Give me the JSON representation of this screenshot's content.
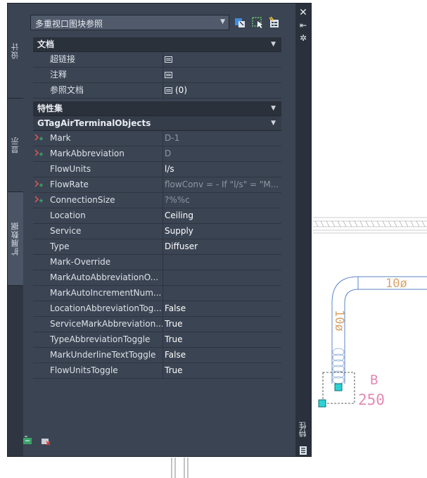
{
  "view_selector": {
    "value": "多重视口图块参照"
  },
  "tabs": [
    {
      "label": "设计"
    },
    {
      "label": "显示"
    },
    {
      "label": "扩展数据"
    }
  ],
  "right_strip": {
    "label": "特性"
  },
  "sections": {
    "document": {
      "title": "文档",
      "rows": [
        {
          "name": "超链接",
          "value": ""
        },
        {
          "name": "注释",
          "value": ""
        },
        {
          "name": "参照文档",
          "value": "(0)"
        }
      ]
    },
    "property_sets": {
      "title": "特性集"
    },
    "gtag": {
      "title": "GTagAirTerminalObjects",
      "rows": [
        {
          "name": "Mark",
          "value": "D-1",
          "dim": true
        },
        {
          "name": "MarkAbbreviation",
          "value": "D",
          "dim": true
        },
        {
          "name": "FlowUnits",
          "value": "l/s"
        },
        {
          "name": "FlowRate",
          "value": "flowConv = - If \"l/s\" = \"M...",
          "dim": true
        },
        {
          "name": "ConnectionSize",
          "value": "?%%c",
          "dim": true
        },
        {
          "name": "Location",
          "value": "Ceiling"
        },
        {
          "name": "Service",
          "value": "Supply"
        },
        {
          "name": "Type",
          "value": "Diffuser"
        },
        {
          "name": "Mark-Override",
          "value": ""
        },
        {
          "name": "MarkAutoAbbreviationO...",
          "value": ""
        },
        {
          "name": "MarkAutoIncrementNum...",
          "value": ""
        },
        {
          "name": "LocationAbbreviationTog...",
          "value": "False"
        },
        {
          "name": "ServiceMarkAbbreviation...",
          "value": "True"
        },
        {
          "name": "TypeAbbreviationToggle",
          "value": "True"
        },
        {
          "name": "MarkUnderlineTextToggle",
          "value": "False"
        },
        {
          "name": "FlowUnitsToggle",
          "value": "True"
        }
      ]
    }
  },
  "drawing": {
    "duct_label_h": "10ø",
    "duct_label_v": "10ø",
    "tag_mark": "B",
    "tag_flow": "250"
  }
}
